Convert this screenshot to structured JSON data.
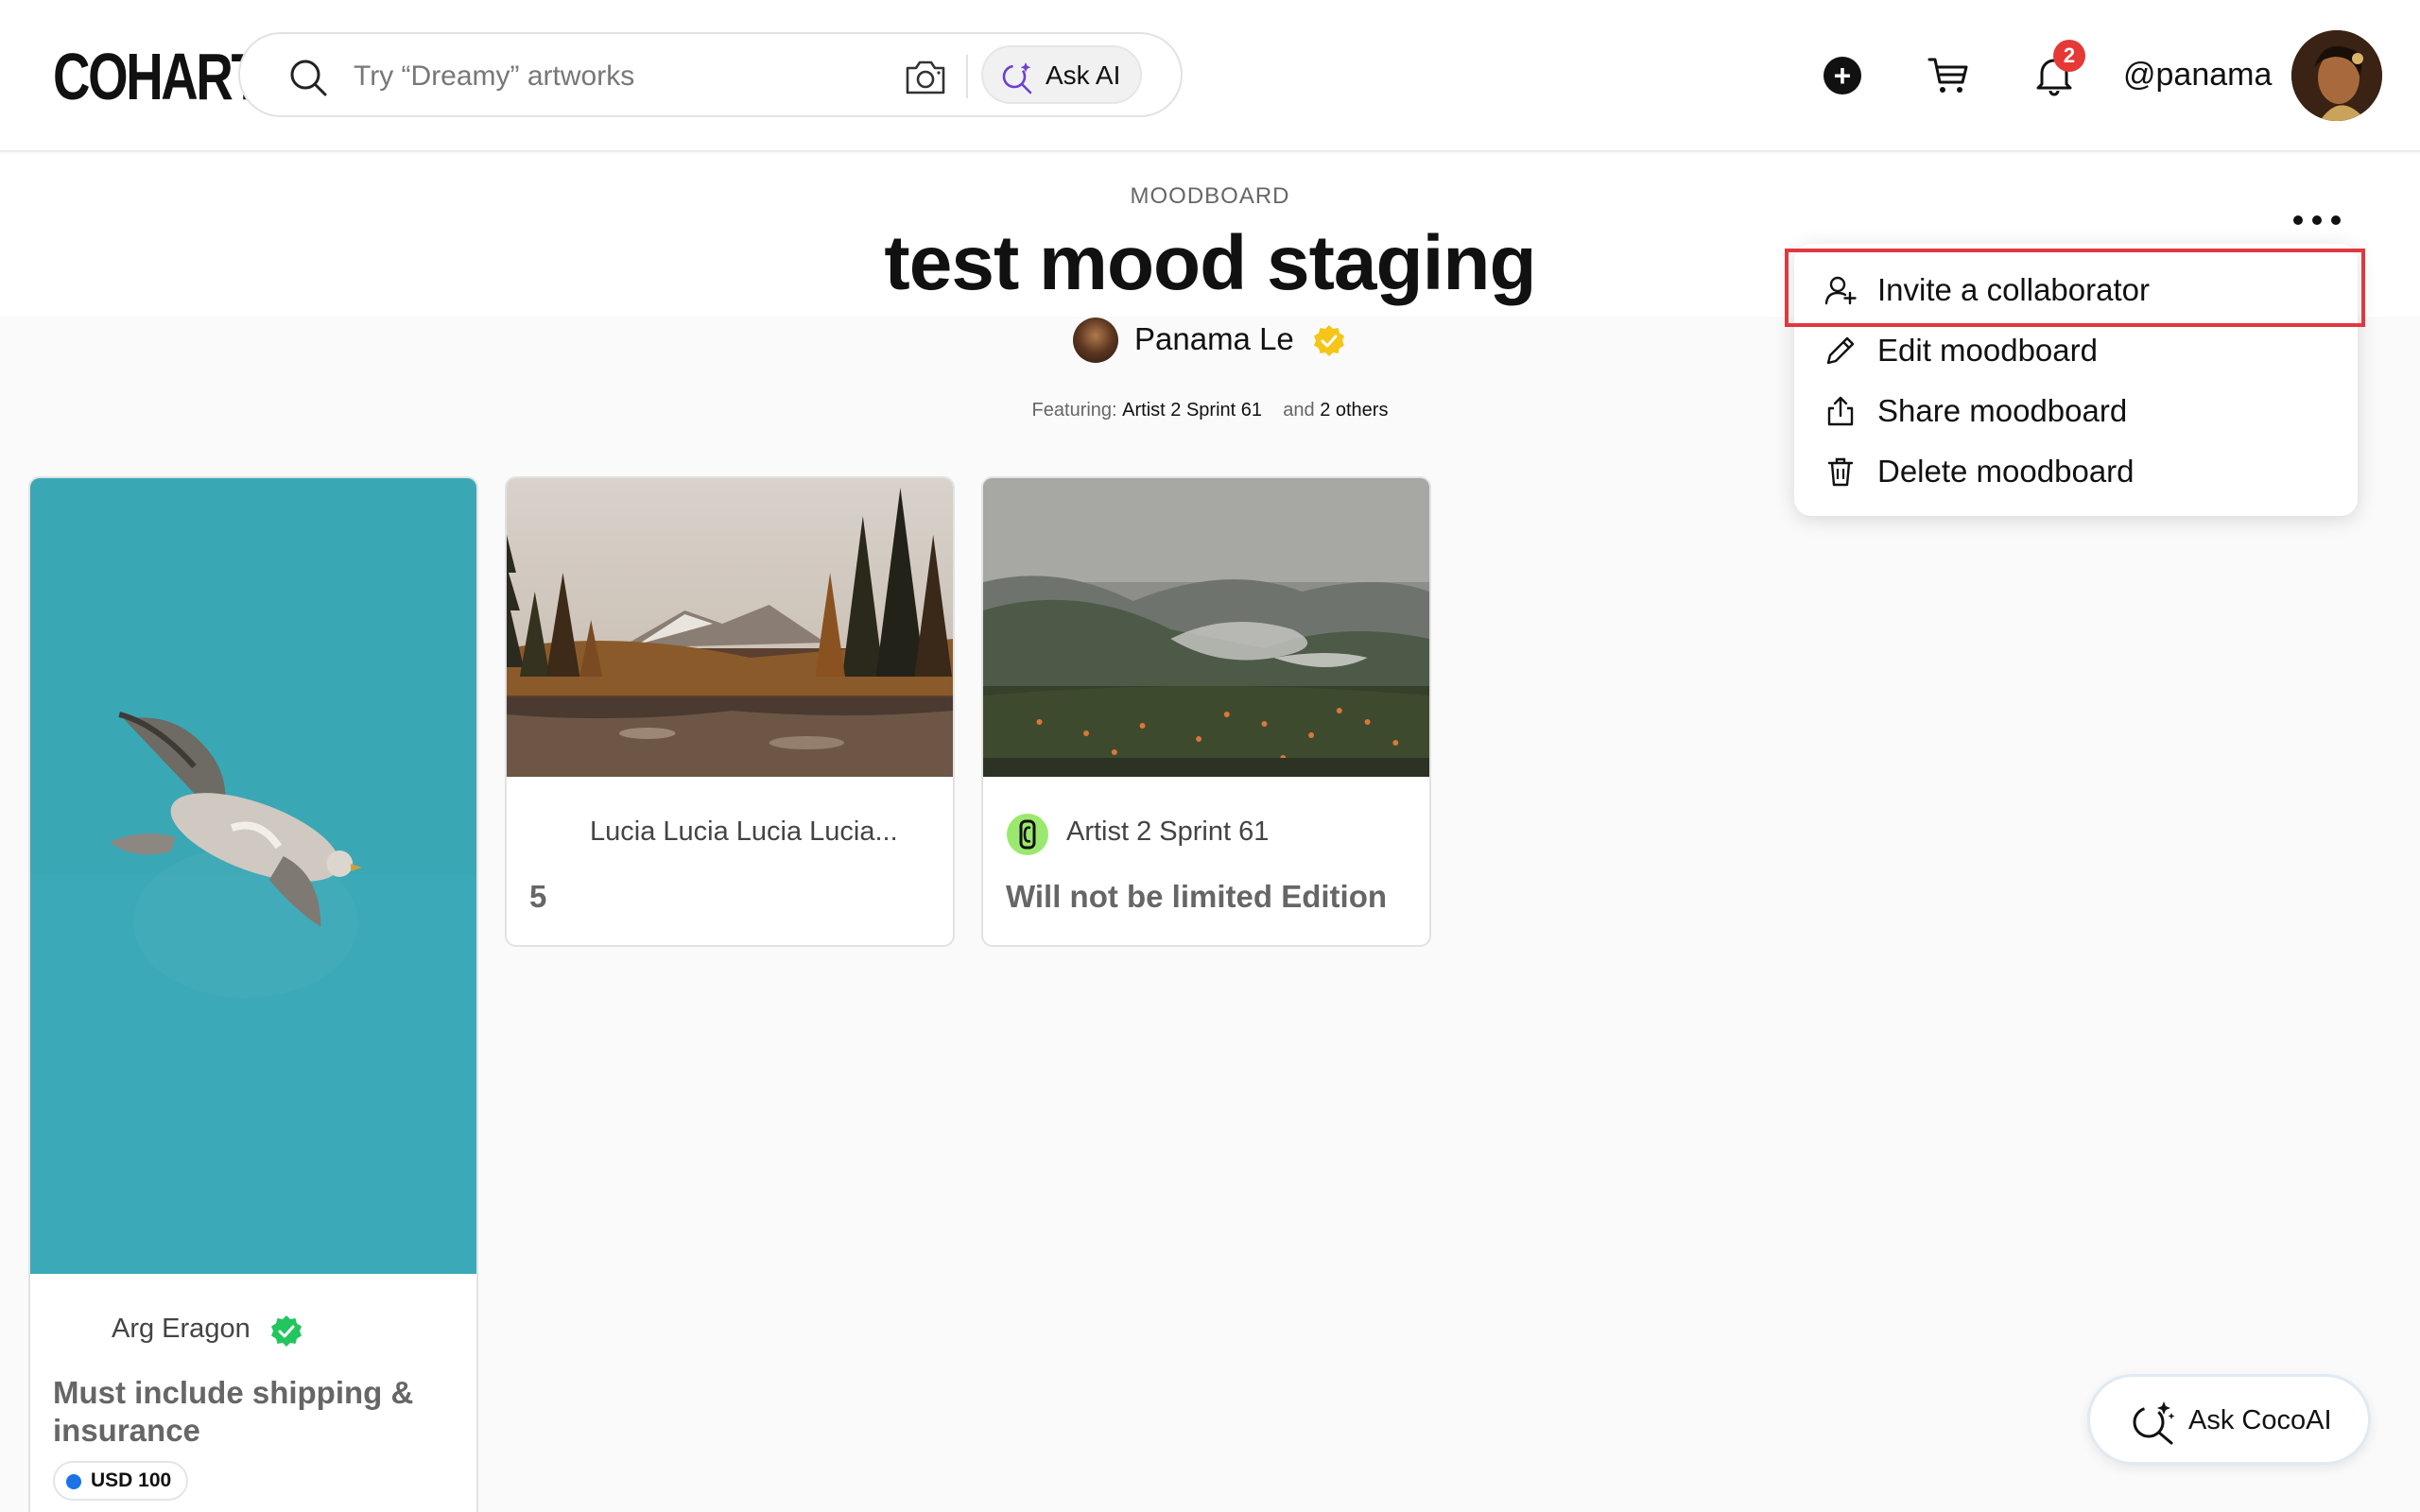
{
  "header": {
    "logo": "COHART",
    "search_placeholder": "Try “Dreamy” artworks",
    "ask_ai_label": "Ask AI",
    "plus_label": "+",
    "notification_count": "2",
    "username": "@panama"
  },
  "moodboard": {
    "eyebrow": "MOODBOARD",
    "title": "test mood staging",
    "owner": "Panama Le",
    "featuring_prefix": "Featuring:",
    "featuring_artist": "Artist 2 Sprint 61",
    "featuring_and": "and",
    "featuring_others": "2 others"
  },
  "menu": {
    "items": [
      {
        "label": "Invite a collaborator",
        "icon": "add-user-icon"
      },
      {
        "label": "Edit moodboard",
        "icon": "pencil-icon"
      },
      {
        "label": "Share moodboard",
        "icon": "share-icon"
      },
      {
        "label": "Delete moodboard",
        "icon": "trash-icon"
      }
    ]
  },
  "cards": [
    {
      "artist": "Arg Eragon",
      "title": "Must include shipping & insurance",
      "price": "USD 100"
    },
    {
      "artist": "Lucia Lucia Lucia Lucia...",
      "title": "5"
    },
    {
      "artist": "Artist 2 Sprint 61",
      "title": "Will not be limited Edition"
    }
  ],
  "assistant": {
    "label": "Ask CocoAI"
  },
  "colors": {
    "accent_red": "#e0383e",
    "verified_green": "#22c55e",
    "verified_gold": "#f5c518",
    "price_dot": "#1a73e8"
  }
}
